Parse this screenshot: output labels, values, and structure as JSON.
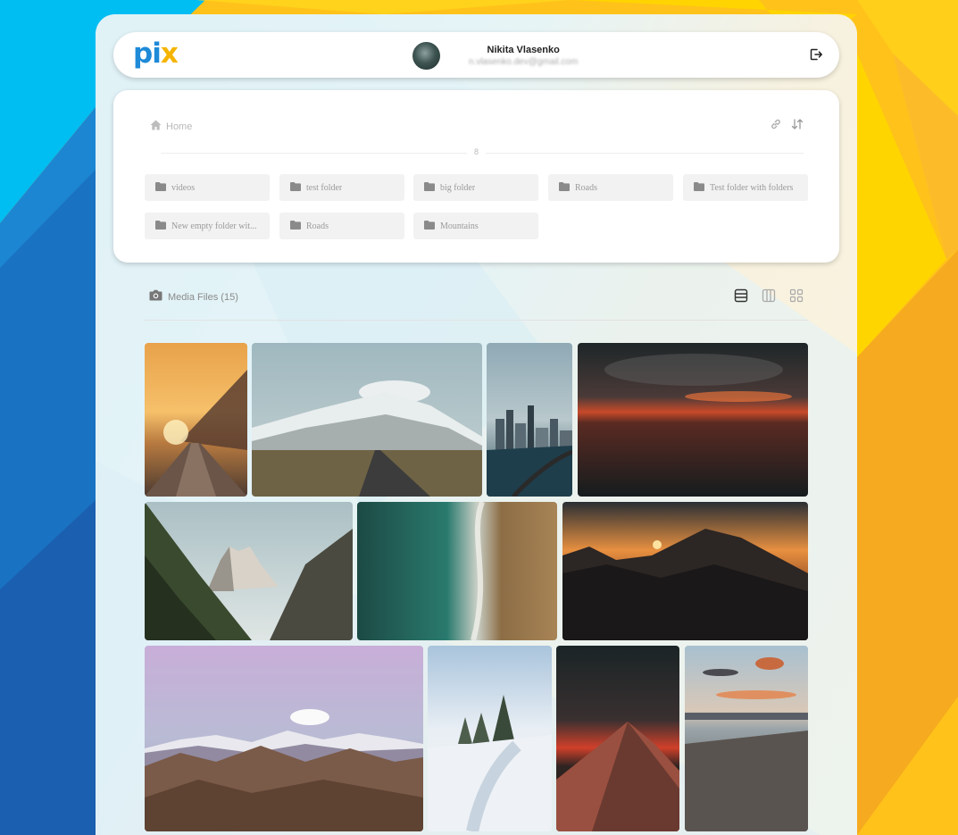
{
  "colors": {
    "bg_cyan": "#00b7f0",
    "bg_blue": "#1f6fc0",
    "bg_yellow": "#ffd000",
    "bg_orange": "#f7b425",
    "logo_blue": "#1e8ad8",
    "logo_yellow": "#f5b400"
  },
  "header": {
    "logo_text": "pi",
    "logo_accent": "x",
    "user_name": "Nikita Vlasenko",
    "user_email": "n.vlasenko.dev@gmail.com",
    "logout_icon": "logout-icon"
  },
  "breadcrumb": {
    "home_icon": "home-icon",
    "home_label": "Home"
  },
  "panel_tools": [
    "link-icon",
    "sort-icon"
  ],
  "folders_count": "8",
  "folders": [
    {
      "label": "videos"
    },
    {
      "label": "test folder"
    },
    {
      "label": "big folder"
    },
    {
      "label": "Roads"
    },
    {
      "label": "Test folder with folders"
    },
    {
      "label": "New empty folder wit..."
    },
    {
      "label": "Roads"
    },
    {
      "label": "Mountains"
    }
  ],
  "media": {
    "camera_icon": "camera-icon",
    "label": "Media Files (15)",
    "view_modes": [
      "rows-view-icon",
      "columns-view-icon",
      "grid-view-icon"
    ]
  },
  "photos": [
    {
      "name": "road-sunset"
    },
    {
      "name": "snowy-mountain-road"
    },
    {
      "name": "city-skyline-lake"
    },
    {
      "name": "red-sunset-sea"
    },
    {
      "name": "dolomites-peaks"
    },
    {
      "name": "aerial-beach"
    },
    {
      "name": "mountain-sunset-silhouette"
    },
    {
      "name": "purple-sky-mountains"
    },
    {
      "name": "snowy-path-trees"
    },
    {
      "name": "red-mountain-ridge"
    },
    {
      "name": "pebble-beach-sunset"
    }
  ]
}
